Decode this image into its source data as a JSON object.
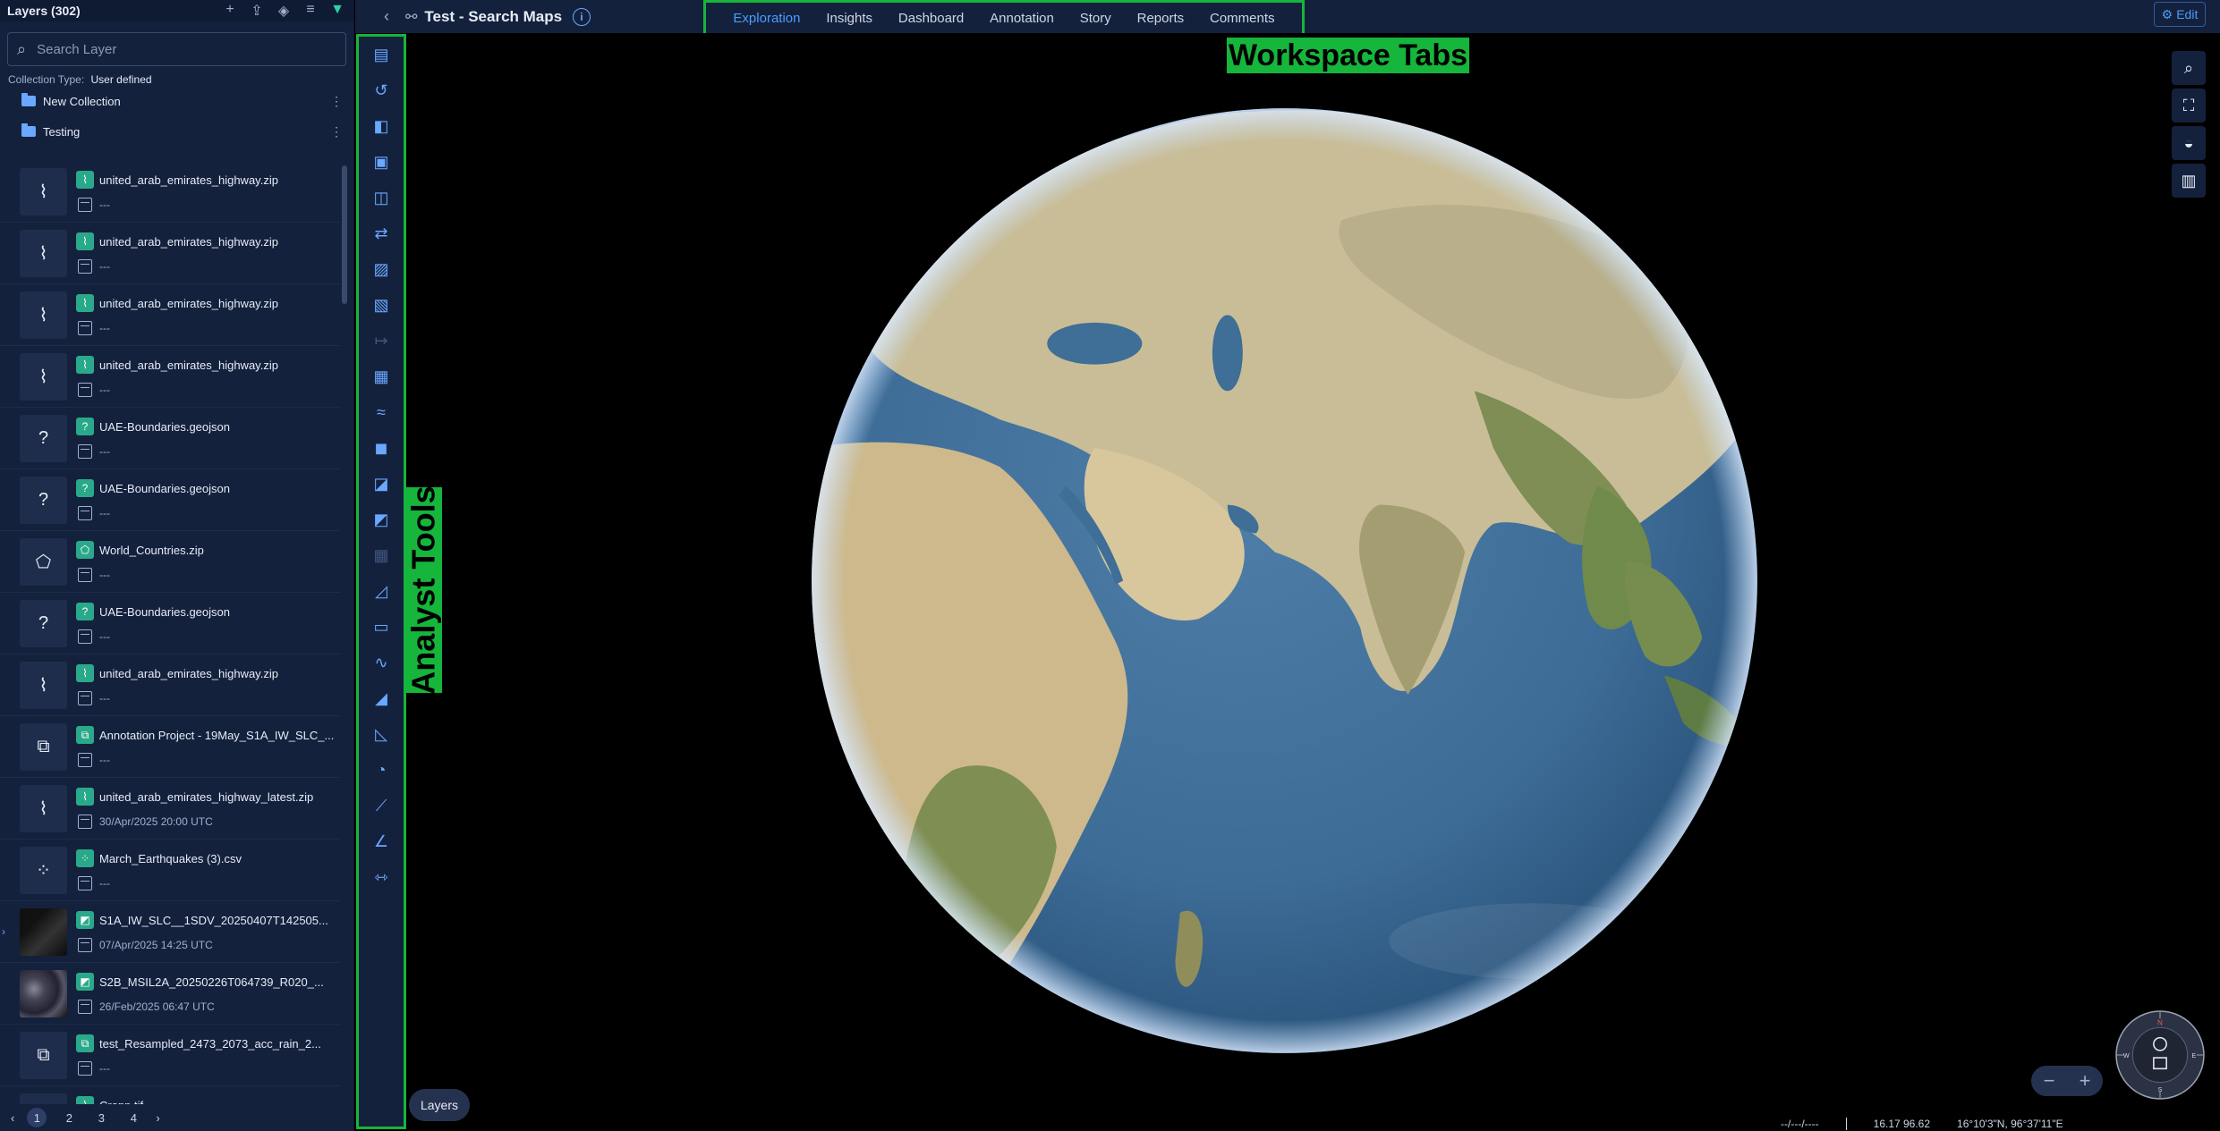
{
  "layers_panel": {
    "title": "Layers (302)",
    "search_placeholder": "Search Layer",
    "collection_type_label": "Collection Type:",
    "collection_type_value": "User defined",
    "folders": [
      "New Collection",
      "Testing"
    ],
    "items": [
      {
        "name": "united_arab_emirates_highway.zip",
        "date": "---",
        "icon": "line-icon",
        "badge": "line-badge-icon"
      },
      {
        "name": "united_arab_emirates_highway.zip",
        "date": "---",
        "icon": "line-icon",
        "badge": "line-badge-icon"
      },
      {
        "name": "united_arab_emirates_highway.zip",
        "date": "---",
        "icon": "line-icon",
        "badge": "line-badge-icon"
      },
      {
        "name": "united_arab_emirates_highway.zip",
        "date": "---",
        "icon": "line-icon",
        "badge": "line-badge-icon"
      },
      {
        "name": "UAE-Boundaries.geojson",
        "date": "---",
        "icon": "question-icon",
        "badge": "question-badge-icon"
      },
      {
        "name": "UAE-Boundaries.geojson",
        "date": "---",
        "icon": "question-icon",
        "badge": "question-badge-icon"
      },
      {
        "name": "World_Countries.zip",
        "date": "---",
        "icon": "polygon-icon",
        "badge": "polygon-badge-icon"
      },
      {
        "name": "UAE-Boundaries.geojson",
        "date": "---",
        "icon": "question-icon",
        "badge": "question-badge-icon"
      },
      {
        "name": "united_arab_emirates_highway.zip",
        "date": "---",
        "icon": "line-icon",
        "badge": "line-badge-icon"
      },
      {
        "name": "Annotation Project - 19May_S1A_IW_SLC_...",
        "date": "---",
        "icon": "annotation-icon",
        "badge": "annotation-badge-icon"
      },
      {
        "name": "united_arab_emirates_highway_latest.zip",
        "date": "30/Apr/2025 20:00 UTC",
        "icon": "line-icon",
        "badge": "line-badge-icon"
      },
      {
        "name": "March_Earthquakes (3).csv",
        "date": "---",
        "icon": "points-icon",
        "badge": "points-badge-icon"
      },
      {
        "name": "S1A_IW_SLC__1SDV_20250407T142505...",
        "date": "07/Apr/2025 14:25 UTC",
        "icon": "image-thumb",
        "badge": "raster-badge-icon"
      },
      {
        "name": "S2B_MSIL2A_20250226T064739_R020_...",
        "date": "26/Feb/2025 06:47 UTC",
        "icon": "image-thumb",
        "badge": "raster-badge-icon"
      },
      {
        "name": "test_Resampled_2473_2073_acc_rain_2...",
        "date": "---",
        "icon": "annotation-icon",
        "badge": "annotation-badge-icon"
      },
      {
        "name": "Cropp.tif",
        "date": "",
        "icon": "line-icon",
        "badge": "line-badge-icon"
      }
    ],
    "pagination": {
      "pages": [
        "1",
        "2",
        "3",
        "4"
      ],
      "current": "1"
    }
  },
  "topbar": {
    "title": "Test - Search Maps",
    "tabs": [
      "Exploration",
      "Insights",
      "Dashboard",
      "Annotation",
      "Story",
      "Reports",
      "Comments"
    ],
    "active_tab": "Exploration",
    "edit_label": "Edit"
  },
  "annotations": {
    "workspace_tabs": "Workspace Tabs",
    "analyst_tools": "Analyst Tools"
  },
  "map": {
    "layers_button": "Layers",
    "status": {
      "date": "--/---/----",
      "scale": "16.17 96.62",
      "coords": "16°10'3\"N, 96°37'11\"E"
    },
    "compass_labels": {
      "n": "N",
      "s": "S",
      "e": "E",
      "w": "W"
    }
  },
  "colors": {
    "accent": "#4a9dff",
    "panel": "#14213d",
    "annotation_green": "#16b53c",
    "badge_teal": "#2aa98a"
  }
}
